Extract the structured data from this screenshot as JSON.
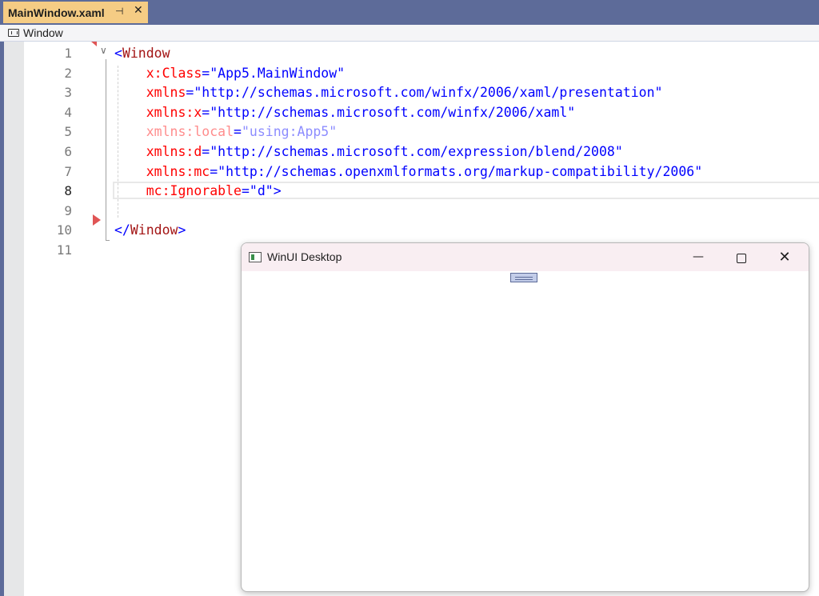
{
  "tab": {
    "title": "MainWindow.xaml",
    "pin_icon": "pin-icon",
    "close_icon": "close-icon"
  },
  "navbar": {
    "label": "Window",
    "icon": "window-element-icon"
  },
  "editor": {
    "line_numbers": [
      "1",
      "2",
      "3",
      "4",
      "5",
      "6",
      "7",
      "8",
      "9",
      "10",
      "11"
    ],
    "active_line": "8",
    "lines": [
      {
        "parts": [
          {
            "c": "br",
            "t": "<"
          },
          {
            "c": "tag",
            "t": "Window"
          }
        ]
      },
      {
        "parts": [
          {
            "c": "sp",
            "t": "    "
          },
          {
            "c": "attr",
            "t": "x:Class"
          },
          {
            "c": "br",
            "t": "="
          },
          {
            "c": "val",
            "t": "\"App5.MainWindow\""
          }
        ]
      },
      {
        "parts": [
          {
            "c": "sp",
            "t": "    "
          },
          {
            "c": "attr",
            "t": "xmlns"
          },
          {
            "c": "br",
            "t": "="
          },
          {
            "c": "val",
            "t": "\"http://schemas.microsoft.com/winfx/2006/xaml/presentation\""
          }
        ]
      },
      {
        "parts": [
          {
            "c": "sp",
            "t": "    "
          },
          {
            "c": "attr",
            "t": "xmlns:x"
          },
          {
            "c": "br",
            "t": "="
          },
          {
            "c": "val",
            "t": "\"http://schemas.microsoft.com/winfx/2006/xaml\""
          }
        ]
      },
      {
        "dim": true,
        "parts": [
          {
            "c": "sp",
            "t": "    "
          },
          {
            "c": "attr",
            "t": "xmlns:local"
          },
          {
            "c": "br",
            "t": "="
          },
          {
            "c": "val",
            "t": "\"using:App5\""
          }
        ]
      },
      {
        "parts": [
          {
            "c": "sp",
            "t": "    "
          },
          {
            "c": "attr",
            "t": "xmlns:d"
          },
          {
            "c": "br",
            "t": "="
          },
          {
            "c": "val",
            "t": "\"http://schemas.microsoft.com/expression/blend/2008\""
          }
        ]
      },
      {
        "parts": [
          {
            "c": "sp",
            "t": "    "
          },
          {
            "c": "attr",
            "t": "xmlns:mc"
          },
          {
            "c": "br",
            "t": "="
          },
          {
            "c": "val",
            "t": "\"http://schemas.openxmlformats.org/markup-compatibility/2006\""
          }
        ]
      },
      {
        "parts": [
          {
            "c": "sp",
            "t": "    "
          },
          {
            "c": "attr",
            "t": "mc:Ignorable"
          },
          {
            "c": "br",
            "t": "="
          },
          {
            "c": "val",
            "t": "\"d\""
          },
          {
            "c": "br",
            "t": ">"
          }
        ]
      },
      {
        "parts": []
      },
      {
        "parts": [
          {
            "c": "br",
            "t": "</"
          },
          {
            "c": "tag",
            "t": "Window"
          },
          {
            "c": "br",
            "t": ">"
          }
        ]
      },
      {
        "parts": []
      }
    ]
  },
  "winui": {
    "title": "WinUI Desktop",
    "minimize_glyph": "—",
    "close_glyph": "✕",
    "icon": "app-window-icon"
  },
  "colors": {
    "tab_active": "#f5cc84",
    "chrome": "#5d6b99",
    "tag": "#a31515",
    "attribute": "#ff0000",
    "value": "#0000ff"
  }
}
